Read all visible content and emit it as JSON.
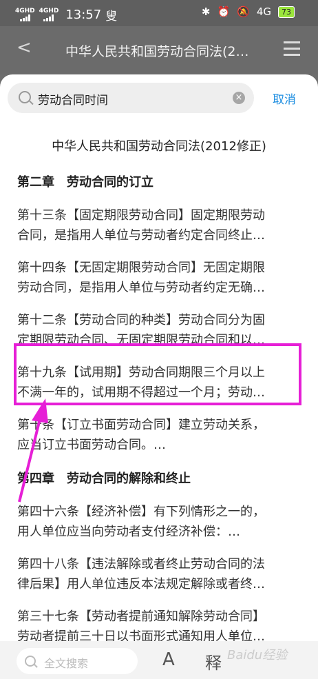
{
  "status": {
    "sig1": "4GHD",
    "sig2": "4GHD",
    "time": "13:57",
    "app_badge": "叟",
    "net": "4G",
    "battery": "73"
  },
  "nav": {
    "title": "中华人民共和国劳动合同法(2…"
  },
  "search": {
    "value": "劳动合同时间",
    "cancel": "取消"
  },
  "doc_title": "中华人民共和国劳动合同法(2012修正)",
  "chapter2": "第二章　劳动合同的订立",
  "results1": [
    {
      "l1": "第十三条【固定期限劳动合同】固定期限劳动",
      "l2": "合同，是指用人单位与劳动者约定合同终止…"
    },
    {
      "l1": "第十四条【无固定期限劳动合同】无固定期限",
      "l2": "劳动合同，是指用人单位与劳动者约定无确…"
    },
    {
      "l1": "第十二条【劳动合同的种类】劳动合同分为固",
      "l2": "定期限劳动合同、无固定期限劳动合同和以…"
    },
    {
      "l1": "第十九条【试用期】劳动合同期限三个月以上",
      "l2": "不满一年的，试用期不得超过一个月；劳动…"
    },
    {
      "l1": "第十条【订立书面劳动合同】建立劳动关系，",
      "l2": "应当订立书面劳动合同。…"
    }
  ],
  "chapter4": "第四章　劳动合同的解除和终止",
  "results2": [
    {
      "l1": "第四十六条【经济补偿】有下列情形之一的，",
      "l2": "用人单位应当向劳动者支付经济补偿：…"
    },
    {
      "l1": "第四十八条【违法解除或者终止劳动合同的法",
      "l2": "律后果】用人单位违反本法规定解除或者终…"
    },
    {
      "l1": "第三十七条【劳动者提前通知解除劳动合同】",
      "l2": "劳动者提前三十日以书面形式通知用人单位…"
    }
  ],
  "bottom": {
    "search_placeholder": "全文搜索",
    "font_label": "A",
    "shi_label": "释",
    "watermark": "Baidu经验"
  },
  "colors": {
    "highlight": "#e61fd6",
    "accent": "#1c8de0"
  }
}
